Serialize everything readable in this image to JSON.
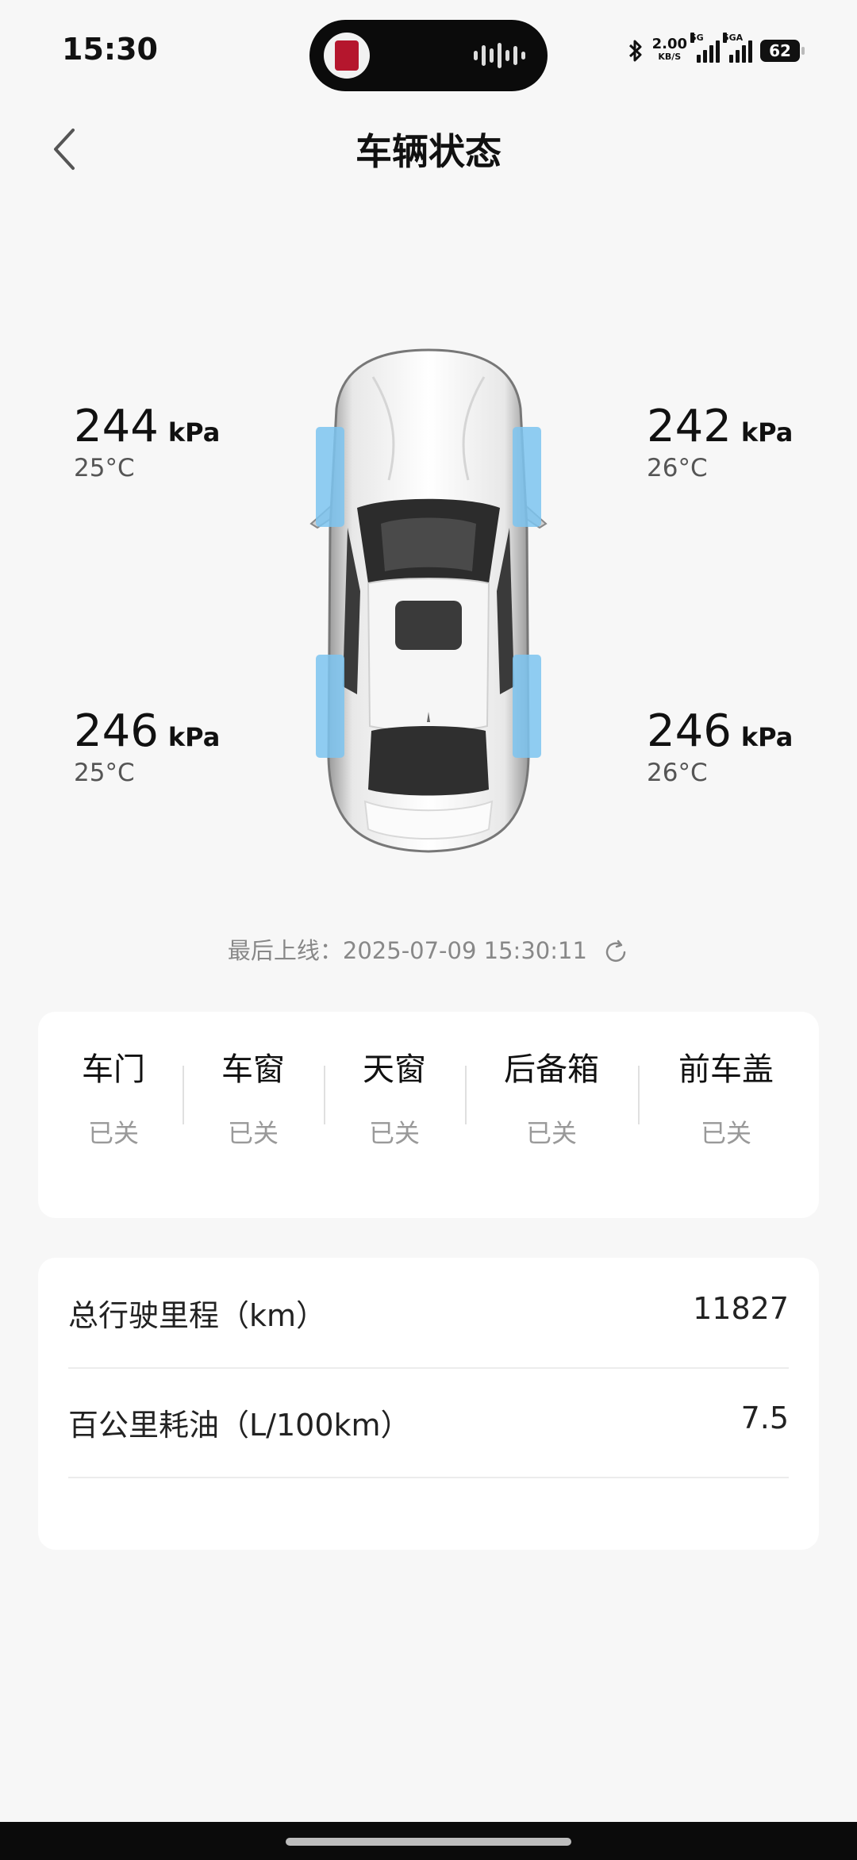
{
  "status_bar": {
    "time": "15:30",
    "net_speed": "2.00",
    "net_speed_unit": "KB/S",
    "signal1_label": "5G",
    "signal2_label": "5GA",
    "battery": "62"
  },
  "header": {
    "title": "车辆状态"
  },
  "tires": {
    "front_left": {
      "pressure": "244",
      "unit": "kPa",
      "temperature": "25°C"
    },
    "front_right": {
      "pressure": "242",
      "unit": "kPa",
      "temperature": "26°C"
    },
    "rear_left": {
      "pressure": "246",
      "unit": "kPa",
      "temperature": "25°C"
    },
    "rear_right": {
      "pressure": "246",
      "unit": "kPa",
      "temperature": "26°C"
    }
  },
  "last_online": "最后上线：2025-07-09 15:30:11",
  "closures": [
    {
      "label": "车门",
      "status": "已关"
    },
    {
      "label": "车窗",
      "status": "已关"
    },
    {
      "label": "天窗",
      "status": "已关"
    },
    {
      "label": "后备箱",
      "status": "已关"
    },
    {
      "label": "前车盖",
      "status": "已关"
    }
  ],
  "stats": [
    {
      "label": "总行驶里程（km）",
      "value": "11827"
    },
    {
      "label": "百公里耗油（L/100km）",
      "value": "7.5"
    }
  ],
  "colors": {
    "tire_highlight": "#7cc4f0",
    "muted_text": "#999999"
  },
  "icons": {
    "back": "chevron-left-icon",
    "refresh": "refresh-icon",
    "bluetooth": "bluetooth-icon"
  }
}
